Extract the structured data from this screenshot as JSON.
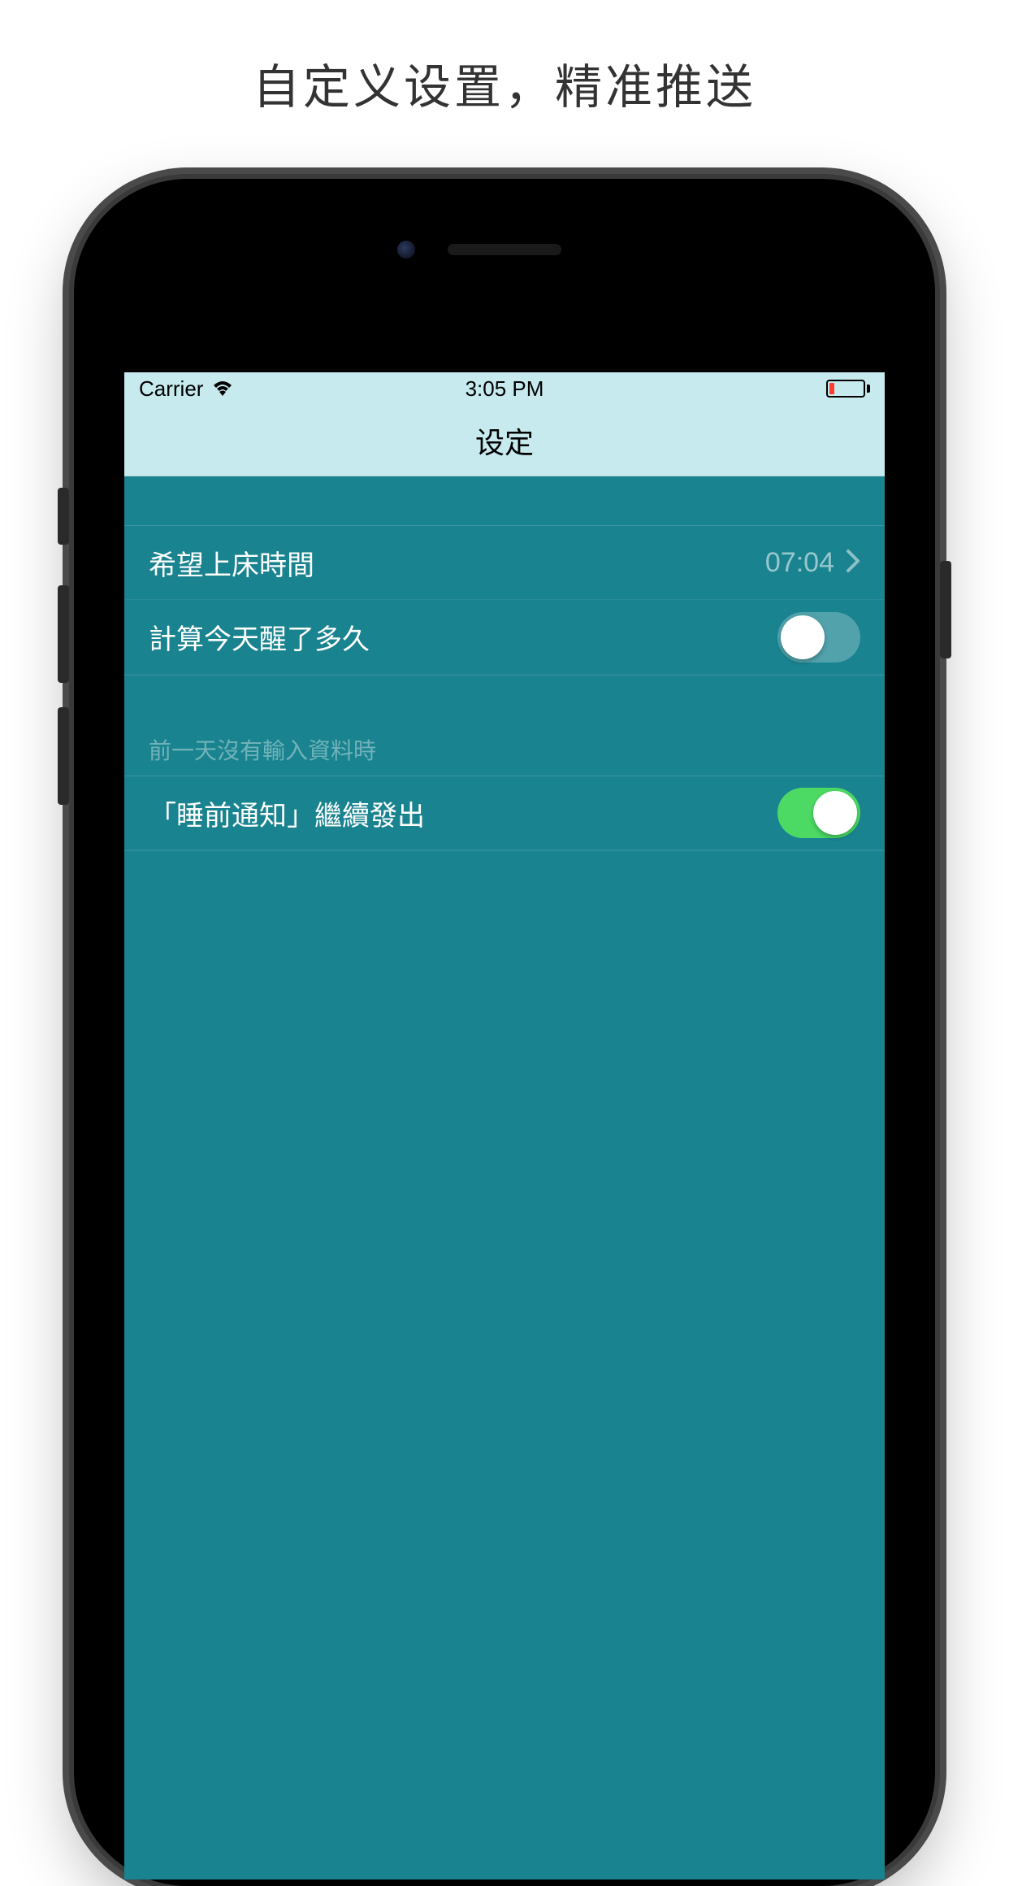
{
  "headline": "自定义设置，精准推送",
  "status_bar": {
    "carrier": "Carrier",
    "time": "3:05 PM"
  },
  "nav": {
    "title": "设定"
  },
  "settings": {
    "bedtime": {
      "label": "希望上床時間",
      "value": "07:04"
    },
    "awake_today": {
      "label": "計算今天醒了多久",
      "on": false
    },
    "section_header": "前一天沒有輸入資料時",
    "notify_continue": {
      "label": "「睡前通知」繼續發出",
      "on": true
    }
  }
}
